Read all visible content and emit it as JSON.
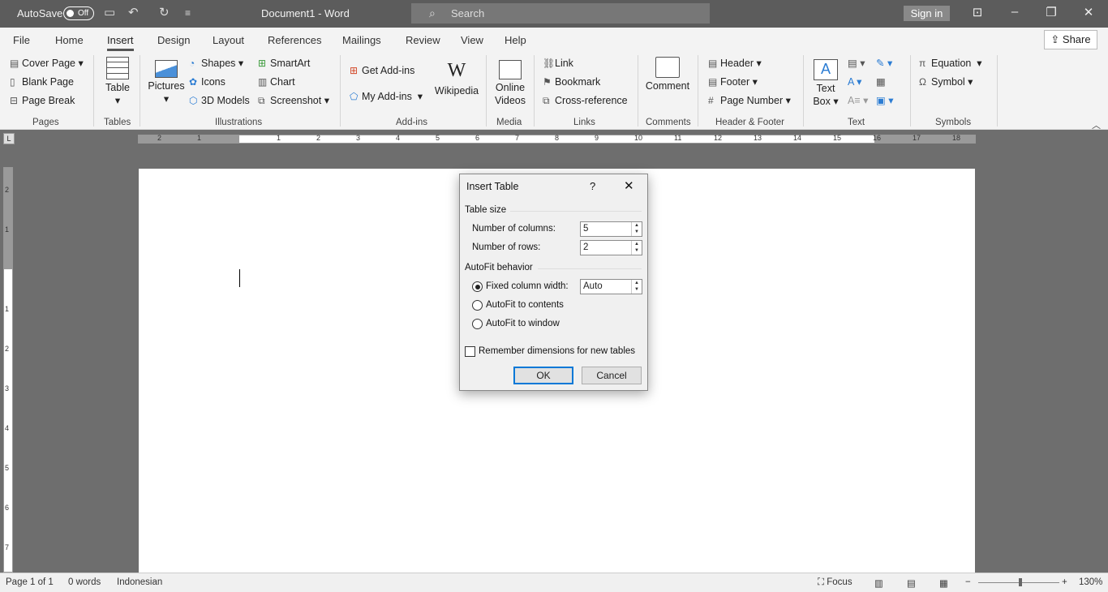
{
  "titlebar": {
    "autosave": "AutoSave",
    "toggle": "Off",
    "doc_title": "Document1 - Word",
    "search_placeholder": "Search",
    "sign_in": "Sign in"
  },
  "tabs": [
    "File",
    "Home",
    "Insert",
    "Design",
    "Layout",
    "References",
    "Mailings",
    "Review",
    "View",
    "Help"
  ],
  "share": "Share",
  "ribbon": {
    "pages": {
      "label": "Pages",
      "items": [
        "Cover Page",
        "Blank Page",
        "Page Break"
      ]
    },
    "tables": {
      "label": "Tables",
      "table": "Table"
    },
    "illustrations": {
      "label": "Illustrations",
      "pictures": "Pictures",
      "shapes": "Shapes",
      "icons": "Icons",
      "models": "3D Models",
      "smartart": "SmartArt",
      "chart": "Chart",
      "screenshot": "Screenshot"
    },
    "addins": {
      "label": "Add-ins",
      "get": "Get Add-ins",
      "my": "My Add-ins",
      "wikipedia": "Wikipedia"
    },
    "media": {
      "label": "Media",
      "online1": "Online",
      "online2": "Videos"
    },
    "links": {
      "label": "Links",
      "link": "Link",
      "bookmark": "Bookmark",
      "crossref": "Cross-reference"
    },
    "comments": {
      "label": "Comments",
      "comment": "Comment"
    },
    "hf": {
      "label": "Header & Footer",
      "header": "Header",
      "footer": "Footer",
      "pagenum": "Page Number"
    },
    "text": {
      "label": "Text",
      "textbox1": "Text",
      "textbox2": "Box"
    },
    "symbols": {
      "label": "Symbols",
      "equation": "Equation",
      "symbol": "Symbol"
    }
  },
  "dialog": {
    "title": "Insert Table",
    "help": "?",
    "table_size": "Table size",
    "columns_label": "Number of columns:",
    "columns_value": "5",
    "rows_label": "Number of rows:",
    "rows_value": "2",
    "autofit_behavior": "AutoFit behavior",
    "fixed": "Fixed column width:",
    "fixed_value": "Auto",
    "autofit_contents": "AutoFit to contents",
    "autofit_window": "AutoFit to window",
    "remember": "Remember dimensions for new tables",
    "ok": "OK",
    "cancel": "Cancel"
  },
  "status": {
    "page": "Page 1 of 1",
    "words": "0 words",
    "language": "Indonesian",
    "focus": "Focus",
    "zoom": "130%"
  }
}
